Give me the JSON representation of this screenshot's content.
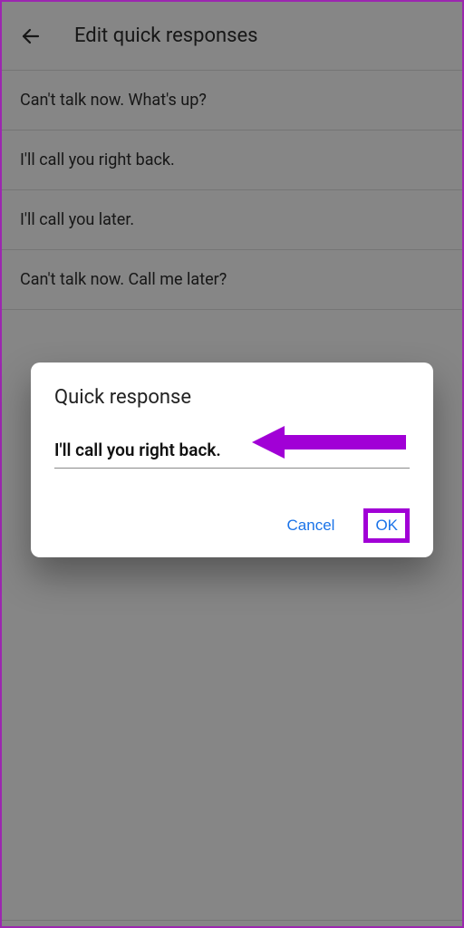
{
  "header": {
    "title": "Edit quick responses"
  },
  "responses": [
    "Can't talk now. What's up?",
    "I'll call you right back.",
    "I'll call you later.",
    "Can't talk now. Call me later?"
  ],
  "dialog": {
    "title": "Quick response",
    "input_value": "I'll call you right back.",
    "cancel_label": "Cancel",
    "ok_label": "OK"
  },
  "colors": {
    "accent": "#1a73e8",
    "annotation": "#a100d6"
  }
}
